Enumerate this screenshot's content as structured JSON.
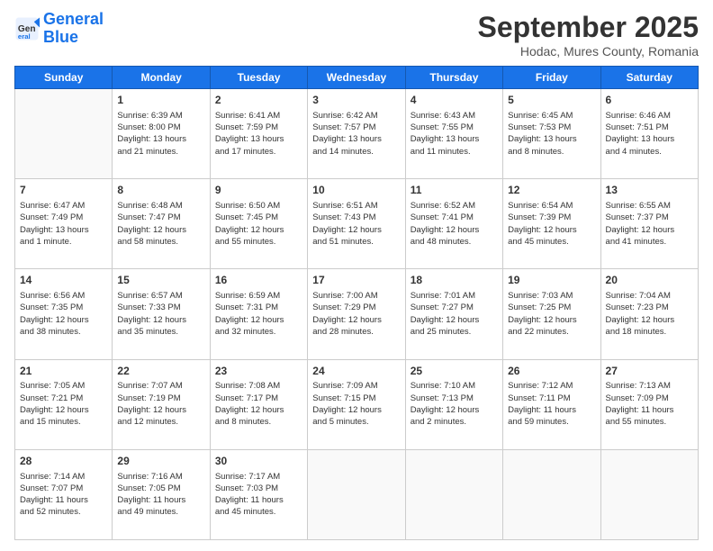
{
  "logo": {
    "line1": "General",
    "line2": "Blue"
  },
  "title": "September 2025",
  "subtitle": "Hodac, Mures County, Romania",
  "weekdays": [
    "Sunday",
    "Monday",
    "Tuesday",
    "Wednesday",
    "Thursday",
    "Friday",
    "Saturday"
  ],
  "weeks": [
    [
      {
        "day": "",
        "text": ""
      },
      {
        "day": "1",
        "text": "Sunrise: 6:39 AM\nSunset: 8:00 PM\nDaylight: 13 hours\nand 21 minutes."
      },
      {
        "day": "2",
        "text": "Sunrise: 6:41 AM\nSunset: 7:59 PM\nDaylight: 13 hours\nand 17 minutes."
      },
      {
        "day": "3",
        "text": "Sunrise: 6:42 AM\nSunset: 7:57 PM\nDaylight: 13 hours\nand 14 minutes."
      },
      {
        "day": "4",
        "text": "Sunrise: 6:43 AM\nSunset: 7:55 PM\nDaylight: 13 hours\nand 11 minutes."
      },
      {
        "day": "5",
        "text": "Sunrise: 6:45 AM\nSunset: 7:53 PM\nDaylight: 13 hours\nand 8 minutes."
      },
      {
        "day": "6",
        "text": "Sunrise: 6:46 AM\nSunset: 7:51 PM\nDaylight: 13 hours\nand 4 minutes."
      }
    ],
    [
      {
        "day": "7",
        "text": "Sunrise: 6:47 AM\nSunset: 7:49 PM\nDaylight: 13 hours\nand 1 minute."
      },
      {
        "day": "8",
        "text": "Sunrise: 6:48 AM\nSunset: 7:47 PM\nDaylight: 12 hours\nand 58 minutes."
      },
      {
        "day": "9",
        "text": "Sunrise: 6:50 AM\nSunset: 7:45 PM\nDaylight: 12 hours\nand 55 minutes."
      },
      {
        "day": "10",
        "text": "Sunrise: 6:51 AM\nSunset: 7:43 PM\nDaylight: 12 hours\nand 51 minutes."
      },
      {
        "day": "11",
        "text": "Sunrise: 6:52 AM\nSunset: 7:41 PM\nDaylight: 12 hours\nand 48 minutes."
      },
      {
        "day": "12",
        "text": "Sunrise: 6:54 AM\nSunset: 7:39 PM\nDaylight: 12 hours\nand 45 minutes."
      },
      {
        "day": "13",
        "text": "Sunrise: 6:55 AM\nSunset: 7:37 PM\nDaylight: 12 hours\nand 41 minutes."
      }
    ],
    [
      {
        "day": "14",
        "text": "Sunrise: 6:56 AM\nSunset: 7:35 PM\nDaylight: 12 hours\nand 38 minutes."
      },
      {
        "day": "15",
        "text": "Sunrise: 6:57 AM\nSunset: 7:33 PM\nDaylight: 12 hours\nand 35 minutes."
      },
      {
        "day": "16",
        "text": "Sunrise: 6:59 AM\nSunset: 7:31 PM\nDaylight: 12 hours\nand 32 minutes."
      },
      {
        "day": "17",
        "text": "Sunrise: 7:00 AM\nSunset: 7:29 PM\nDaylight: 12 hours\nand 28 minutes."
      },
      {
        "day": "18",
        "text": "Sunrise: 7:01 AM\nSunset: 7:27 PM\nDaylight: 12 hours\nand 25 minutes."
      },
      {
        "day": "19",
        "text": "Sunrise: 7:03 AM\nSunset: 7:25 PM\nDaylight: 12 hours\nand 22 minutes."
      },
      {
        "day": "20",
        "text": "Sunrise: 7:04 AM\nSunset: 7:23 PM\nDaylight: 12 hours\nand 18 minutes."
      }
    ],
    [
      {
        "day": "21",
        "text": "Sunrise: 7:05 AM\nSunset: 7:21 PM\nDaylight: 12 hours\nand 15 minutes."
      },
      {
        "day": "22",
        "text": "Sunrise: 7:07 AM\nSunset: 7:19 PM\nDaylight: 12 hours\nand 12 minutes."
      },
      {
        "day": "23",
        "text": "Sunrise: 7:08 AM\nSunset: 7:17 PM\nDaylight: 12 hours\nand 8 minutes."
      },
      {
        "day": "24",
        "text": "Sunrise: 7:09 AM\nSunset: 7:15 PM\nDaylight: 12 hours\nand 5 minutes."
      },
      {
        "day": "25",
        "text": "Sunrise: 7:10 AM\nSunset: 7:13 PM\nDaylight: 12 hours\nand 2 minutes."
      },
      {
        "day": "26",
        "text": "Sunrise: 7:12 AM\nSunset: 7:11 PM\nDaylight: 11 hours\nand 59 minutes."
      },
      {
        "day": "27",
        "text": "Sunrise: 7:13 AM\nSunset: 7:09 PM\nDaylight: 11 hours\nand 55 minutes."
      }
    ],
    [
      {
        "day": "28",
        "text": "Sunrise: 7:14 AM\nSunset: 7:07 PM\nDaylight: 11 hours\nand 52 minutes."
      },
      {
        "day": "29",
        "text": "Sunrise: 7:16 AM\nSunset: 7:05 PM\nDaylight: 11 hours\nand 49 minutes."
      },
      {
        "day": "30",
        "text": "Sunrise: 7:17 AM\nSunset: 7:03 PM\nDaylight: 11 hours\nand 45 minutes."
      },
      {
        "day": "",
        "text": ""
      },
      {
        "day": "",
        "text": ""
      },
      {
        "day": "",
        "text": ""
      },
      {
        "day": "",
        "text": ""
      }
    ]
  ]
}
